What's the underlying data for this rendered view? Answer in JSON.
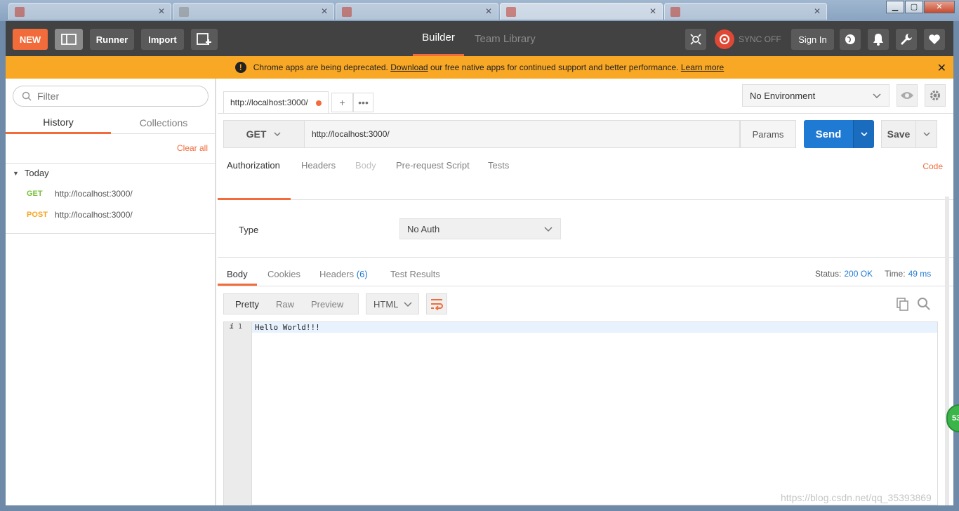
{
  "os": {
    "window_controls": [
      "minimize",
      "maximize",
      "close"
    ]
  },
  "topbar": {
    "new_label": "NEW",
    "runner_label": "Runner",
    "import_label": "Import",
    "builder_label": "Builder",
    "team_library_label": "Team Library",
    "sync_label": "SYNC OFF",
    "signin_label": "Sign In"
  },
  "banner": {
    "text_before": "Chrome apps are being deprecated.",
    "download_link": "Download",
    "text_middle": "our free native apps for continued support and better performance.",
    "learn_more_link": "Learn more",
    "bg_color": "#f9a825"
  },
  "sidebar": {
    "filter_placeholder": "Filter",
    "tabs": [
      {
        "label": "History"
      },
      {
        "label": "Collections"
      }
    ],
    "clear_all_label": "Clear all",
    "group_label": "Today",
    "history": [
      {
        "method": "GET",
        "url": "http://localhost:3000/"
      },
      {
        "method": "POST",
        "url": "http://localhost:3000/"
      }
    ]
  },
  "request_tab": {
    "label": "http://localhost:3000/",
    "add_label": "+",
    "more_label": "•••"
  },
  "environment": {
    "selected": "No Environment"
  },
  "request": {
    "method": "GET",
    "url": "http://localhost:3000/",
    "params_label": "Params",
    "send_label": "Send",
    "save_label": "Save"
  },
  "request_tabs": [
    {
      "label": "Authorization"
    },
    {
      "label": "Headers"
    },
    {
      "label": "Body"
    },
    {
      "label": "Pre-request Script"
    },
    {
      "label": "Tests"
    }
  ],
  "code_link": "Code",
  "auth": {
    "type_label": "Type",
    "selected": "No Auth"
  },
  "response": {
    "tabs": [
      {
        "label": "Body"
      },
      {
        "label": "Cookies"
      },
      {
        "label": "Headers",
        "count": "(6)"
      },
      {
        "label": "Test Results"
      }
    ],
    "status_label": "Status:",
    "status_value": "200 OK",
    "time_label": "Time:",
    "time_value": "49 ms",
    "view_modes": [
      "Pretty",
      "Raw",
      "Preview"
    ],
    "format": "HTML",
    "line_number": "1",
    "body_line": "Hello World!!!"
  },
  "overlay": {
    "badge": "53",
    "watermark": "https://blog.csdn.net/qq_35393869"
  },
  "colors": {
    "accent": "#f26b3a",
    "send": "#1f7ad4",
    "topbar": "#424242"
  }
}
